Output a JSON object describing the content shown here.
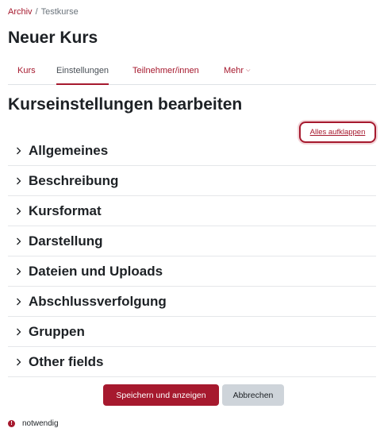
{
  "breadcrumb": {
    "items": [
      "Archiv",
      "Testkurse"
    ],
    "separator": "/"
  },
  "page": {
    "title": "Neuer Kurs"
  },
  "tabs": [
    {
      "label": "Kurs",
      "active": false
    },
    {
      "label": "Einstellungen",
      "active": true
    },
    {
      "label": "Teilnehmer/innen",
      "active": false
    },
    {
      "label": "Mehr",
      "active": false,
      "icon": "chevron-down-icon"
    }
  ],
  "form": {
    "heading": "Kurseinstellungen bearbeiten",
    "expand_all_label": "Alles aufklappen",
    "sections": [
      "Allgemeines",
      "Beschreibung",
      "Kursformat",
      "Darstellung",
      "Dateien und Uploads",
      "Abschlussverfolgung",
      "Gruppen",
      "Other fields"
    ],
    "save_label": "Speichern und anzeigen",
    "cancel_label": "Abbrechen",
    "required_note": "notwendig"
  },
  "colors": {
    "accent": "#a6192e",
    "text": "#1d2125",
    "secondary_button": "#ced4da",
    "divider": "#e5e7ea"
  }
}
